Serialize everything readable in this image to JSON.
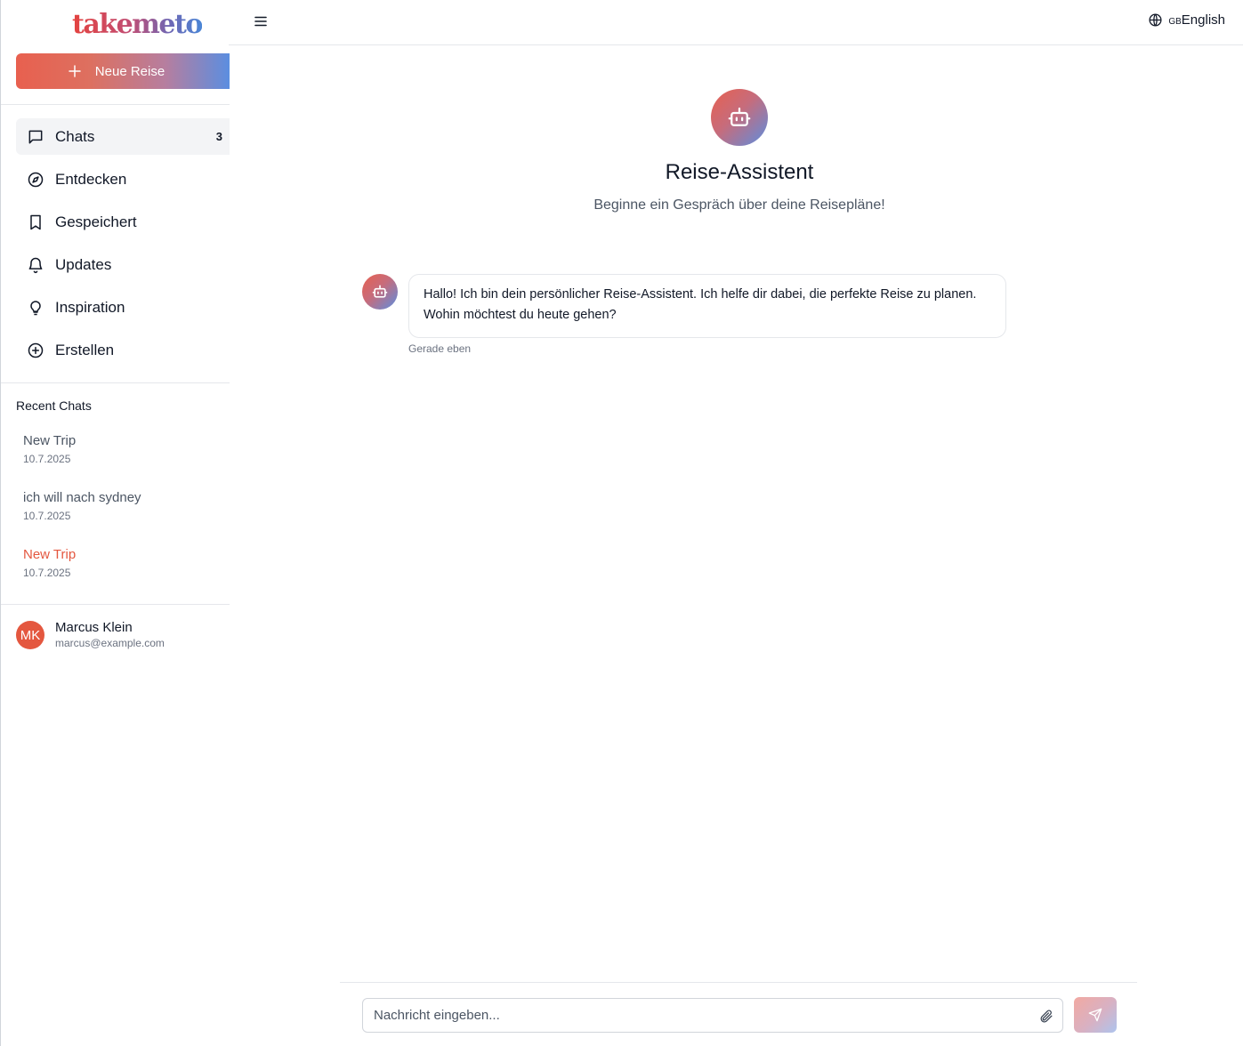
{
  "brand": {
    "logo_text": "takemeto"
  },
  "sidebar": {
    "new_trip_label": "Neue Reise",
    "nav": [
      {
        "label": "Chats",
        "icon": "message-square-icon",
        "badge": "3",
        "active": true
      },
      {
        "label": "Entdecken",
        "icon": "compass-icon"
      },
      {
        "label": "Gespeichert",
        "icon": "bookmark-icon"
      },
      {
        "label": "Updates",
        "icon": "bell-icon"
      },
      {
        "label": "Inspiration",
        "icon": "lightbulb-icon"
      },
      {
        "label": "Erstellen",
        "icon": "plus-circle-icon"
      }
    ],
    "recent_title": "Recent Chats",
    "recent": [
      {
        "title": "New Trip",
        "date": "10.7.2025"
      },
      {
        "title": "ich will nach sydney",
        "date": "10.7.2025"
      },
      {
        "title": "New Trip",
        "date": "10.7.2025",
        "active": true
      }
    ],
    "user": {
      "initials": "MK",
      "name": "Marcus Klein",
      "email": "marcus@example.com"
    }
  },
  "header": {
    "lang_flag": "GB",
    "lang_label": "English"
  },
  "main": {
    "title": "Reise-Assistent",
    "subtitle": "Beginne ein Gespräch über deine Reisepläne!",
    "messages": [
      {
        "line1": "Hallo! Ich bin dein persönlicher Reise-Assistent. Ich helfe dir dabei, die perfekte Reise zu planen.",
        "line2": "Wohin möchtest du heute gehen?",
        "time": "Gerade eben"
      }
    ],
    "composer": {
      "placeholder": "Nachricht eingeben..."
    }
  },
  "colors": {
    "accent_red": "#e4573f",
    "accent_blue": "#5b8ee0",
    "border": "#e5e7eb"
  }
}
